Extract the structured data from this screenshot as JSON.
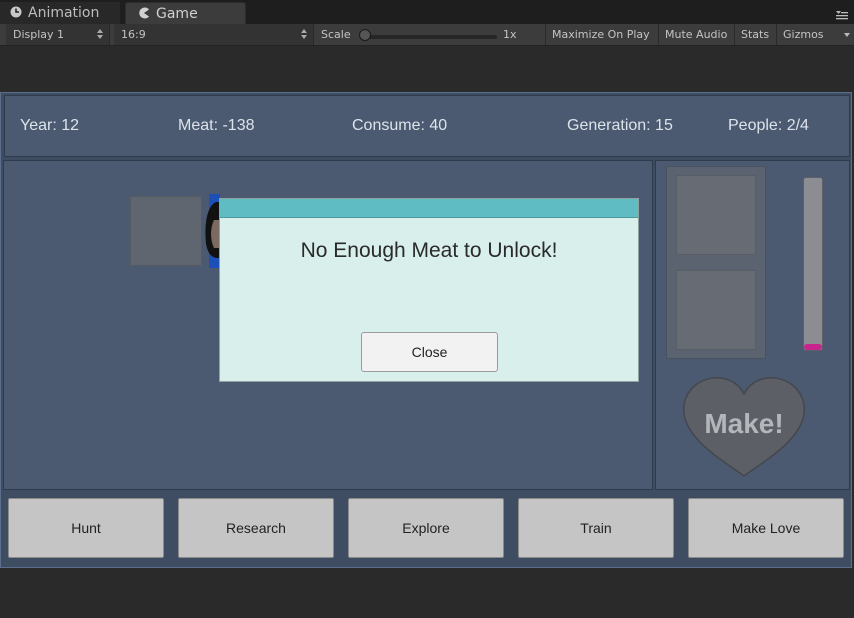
{
  "editor": {
    "tabs": [
      {
        "label": "Animation",
        "icon": "clock-icon",
        "active": false
      },
      {
        "label": "Game",
        "icon": "pacman-icon",
        "active": true
      }
    ],
    "toolbar": {
      "display": "Display 1",
      "aspect": "16:9",
      "scale_label": "Scale",
      "scale_value": "1x",
      "maximize_on_play": "Maximize On Play",
      "mute_audio": "Mute Audio",
      "stats": "Stats",
      "gizmos": "Gizmos"
    }
  },
  "game": {
    "stats": {
      "year": "Year: 12",
      "meat": "Meat: -138",
      "consume": "Consume: 40",
      "generation": "Generation: 15",
      "people": "People: 2/4"
    },
    "make_button": "Make!",
    "progress_level": 0.03,
    "actions": [
      "Hunt",
      "Research",
      "Explore",
      "Train",
      "Make Love"
    ]
  },
  "modal": {
    "message": "No Enough Meat to Unlock!",
    "close_label": "Close"
  },
  "colors": {
    "canvas_bg": "#3e4d62",
    "panel_bg": "#4b5a70",
    "modal_bg": "#d8efec",
    "modal_header": "#5ebcc2",
    "progress_fill": "#c8248e"
  }
}
